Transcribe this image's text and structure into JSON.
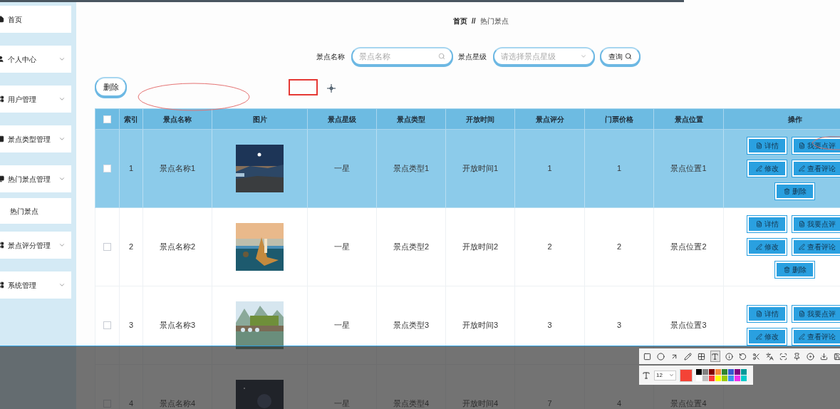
{
  "sidebar": {
    "items": [
      {
        "label": "首页",
        "kind": "link"
      },
      {
        "label": "个人中心",
        "kind": "menu"
      },
      {
        "label": "用户管理",
        "kind": "menu"
      },
      {
        "label": "景点类型管理",
        "kind": "menu"
      },
      {
        "label": "热门景点管理",
        "kind": "menu",
        "children": [
          {
            "label": "热门景点"
          }
        ]
      },
      {
        "label": "景点评分管理",
        "kind": "menu"
      },
      {
        "label": "系统管理",
        "kind": "menu"
      }
    ]
  },
  "breadcrumb": [
    "首页",
    "//",
    "热门景点"
  ],
  "search": {
    "fields": [
      {
        "label": "景点名称",
        "kind": "input",
        "placeholder": "景点名称"
      },
      {
        "label": "景点星级",
        "kind": "select",
        "placeholder": "请选择景点星级"
      }
    ],
    "button": "查询"
  },
  "toolbar": {
    "delete_button": "删除"
  },
  "table": {
    "select_all_checked": false,
    "columns": [
      "索引",
      "景点名称",
      "图片",
      "景点星级",
      "景点类型",
      "开放时间",
      "景点评分",
      "门票价格",
      "景点位置",
      "操作"
    ],
    "rows": [
      {
        "selected": true,
        "checked": false,
        "index": "1",
        "name": "景点名称1",
        "star": "一星",
        "type": "景点类型1",
        "open_time": "开放时间1",
        "score": "1",
        "price": "1",
        "location": "景点位置1",
        "actions": [
          {
            "label": "详情",
            "kind": "doc"
          },
          {
            "label": "我要点评",
            "kind": "doc"
          },
          {
            "label": "修改",
            "kind": "edit"
          },
          {
            "label": "查看评论",
            "kind": "edit"
          },
          {
            "label": "删除",
            "kind": "delete"
          }
        ]
      },
      {
        "selected": false,
        "checked": false,
        "index": "2",
        "name": "景点名称2",
        "star": "一星",
        "type": "景点类型2",
        "open_time": "开放时间2",
        "score": "2",
        "price": "2",
        "location": "景点位置2",
        "actions": [
          {
            "label": "详情",
            "kind": "doc"
          },
          {
            "label": "我要点评",
            "kind": "doc"
          },
          {
            "label": "修改",
            "kind": "edit"
          },
          {
            "label": "查看评论",
            "kind": "edit"
          },
          {
            "label": "删除",
            "kind": "delete"
          }
        ]
      },
      {
        "selected": false,
        "checked": false,
        "index": "3",
        "name": "景点名称3",
        "star": "一星",
        "type": "景点类型3",
        "open_time": "开放时间3",
        "score": "3",
        "price": "3",
        "location": "景点位置3",
        "actions": [
          {
            "label": "详情",
            "kind": "doc"
          },
          {
            "label": "我要点评",
            "kind": "doc"
          },
          {
            "label": "修改",
            "kind": "edit"
          },
          {
            "label": "查看评论",
            "kind": "edit"
          }
        ]
      },
      {
        "selected": false,
        "checked": false,
        "index": "4",
        "name": "景点名称4",
        "star": "一星",
        "type": "景点类型4",
        "open_time": "开放时间4",
        "score": "7",
        "price": "4",
        "location": "景点位置4",
        "actions": []
      }
    ]
  },
  "capture_toolbar": {
    "tools": [
      {
        "kind": "rectangle",
        "selected": false
      },
      {
        "kind": "circle",
        "selected": false
      },
      {
        "kind": "arrow",
        "selected": false
      },
      {
        "kind": "pencil",
        "selected": false
      },
      {
        "kind": "mosaic",
        "selected": false
      },
      {
        "kind": "text",
        "selected": true
      },
      {
        "kind": "number",
        "selected": false
      },
      {
        "kind": "undo",
        "selected": false
      },
      {
        "kind": "scissors",
        "selected": false
      },
      {
        "kind": "translate",
        "selected": false
      },
      {
        "kind": "scan",
        "selected": false
      },
      {
        "kind": "pin",
        "selected": false
      },
      {
        "kind": "record",
        "selected": false
      },
      {
        "kind": "download",
        "selected": false
      },
      {
        "kind": "save",
        "selected": false
      }
    ],
    "font_size": "12",
    "palette": [
      {
        "color": "#000000"
      },
      {
        "color": "#808080"
      },
      {
        "color": "#800000"
      },
      {
        "color": "#f7883a"
      },
      {
        "color": "#308430"
      },
      {
        "color": "#385ad3"
      },
      {
        "color": "#800080"
      },
      {
        "color": "#009999"
      },
      {
        "color": "#ffffff"
      },
      {
        "color": "#c0c0c0"
      },
      {
        "color": "#fb3838"
      },
      {
        "color": "#ffff00"
      },
      {
        "color": "#99cc00"
      },
      {
        "color": "#3895ed"
      },
      {
        "color": "#f031f0"
      },
      {
        "color": "#00cccc"
      }
    ]
  }
}
